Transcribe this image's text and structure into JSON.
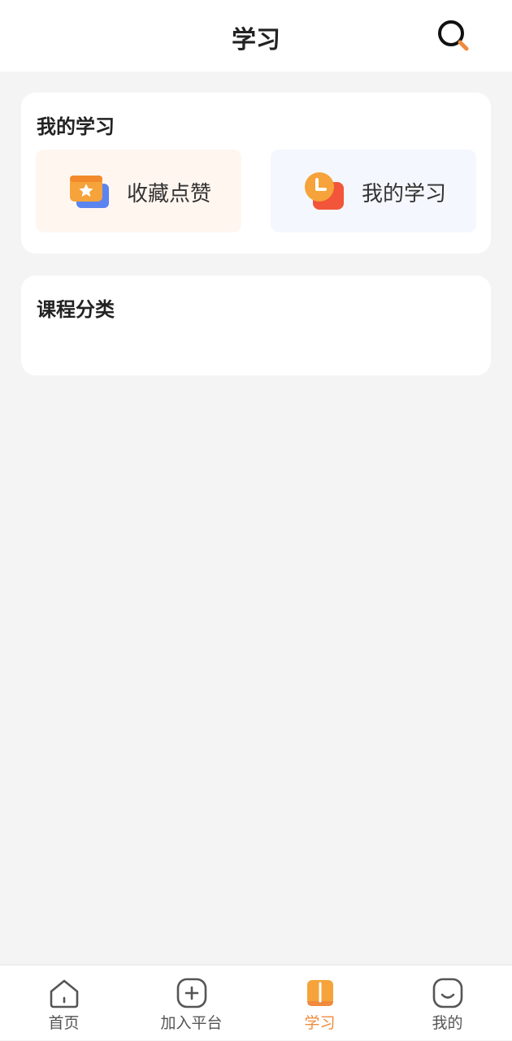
{
  "header": {
    "title": "学习"
  },
  "my_learning": {
    "title": "我的学习",
    "tiles": [
      {
        "label": "收藏点赞",
        "icon": "folder-star-icon"
      },
      {
        "label": "我的学习",
        "icon": "clock-icon"
      }
    ]
  },
  "course_category": {
    "title": "课程分类"
  },
  "tabbar": {
    "active_color": "#f08a3c",
    "items": [
      {
        "label": "首页",
        "icon": "home-icon"
      },
      {
        "label": "加入平台",
        "icon": "plus-square-icon"
      },
      {
        "label": "学习",
        "icon": "book-icon",
        "active": true
      },
      {
        "label": "我的",
        "icon": "smile-icon"
      }
    ]
  }
}
